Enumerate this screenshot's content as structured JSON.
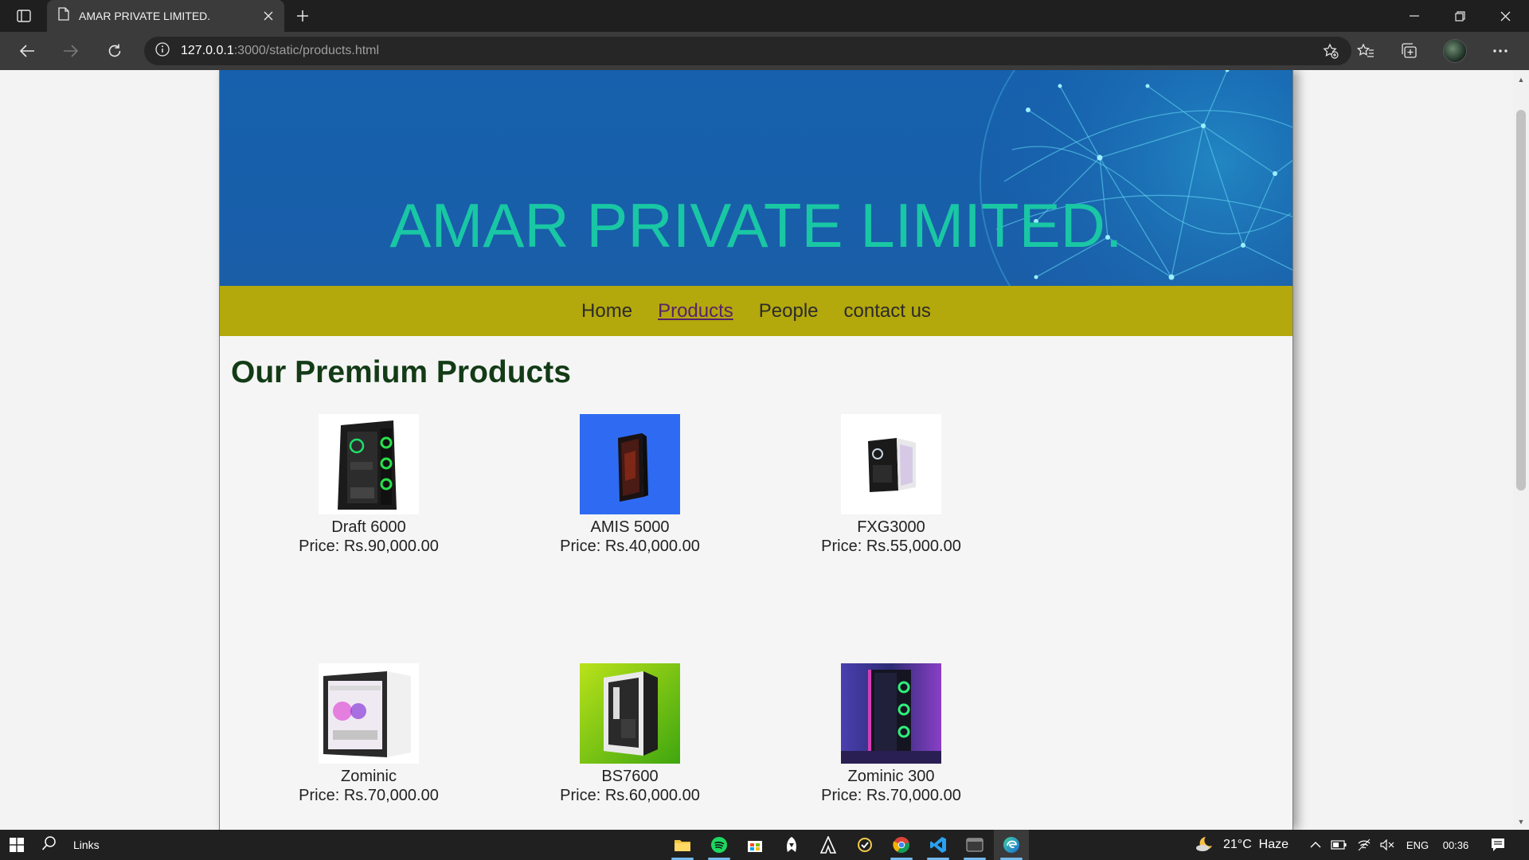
{
  "browser": {
    "tab_title": "AMAR PRIVATE LIMITED.",
    "url_host": "127.0.0.1",
    "url_rest": ":3000/static/products.html"
  },
  "site": {
    "heading": "AMAR PRIVATE LIMITED.",
    "nav": [
      {
        "label": "Home",
        "active": false
      },
      {
        "label": "Products",
        "active": true
      },
      {
        "label": "People",
        "active": false
      },
      {
        "label": "contact us",
        "active": false
      }
    ],
    "section_title": "Our Premium Products",
    "products": [
      {
        "name": "Draft 6000",
        "price": "Price: Rs.90,000.00",
        "image": "black-pc-case-green-fans"
      },
      {
        "name": "AMIS 5000",
        "price": "Price: Rs.40,000.00",
        "image": "dark-pc-case-blue-background"
      },
      {
        "name": "FXG3000",
        "price": "Price: Rs.55,000.00",
        "image": "glass-pc-case-white"
      },
      {
        "name": "Zominic",
        "price": "Price: Rs.70,000.00",
        "image": "white-pc-case-pink-rgb"
      },
      {
        "name": "BS7600",
        "price": "Price: Rs.60,000.00",
        "image": "black-pc-case-green-background"
      },
      {
        "name": "Zominic 300",
        "price": "Price: Rs.70,000.00",
        "image": "black-pc-case-purple-rgb"
      }
    ]
  },
  "taskbar": {
    "search_label": "Links",
    "weather": "21°C  Haze",
    "language": "ENG",
    "time": "00:36"
  },
  "colors": {
    "hero_bg": "#1660ad",
    "hero_text": "#19c7a4",
    "nav_bg": "#b3a80c",
    "title": "#133b16"
  }
}
